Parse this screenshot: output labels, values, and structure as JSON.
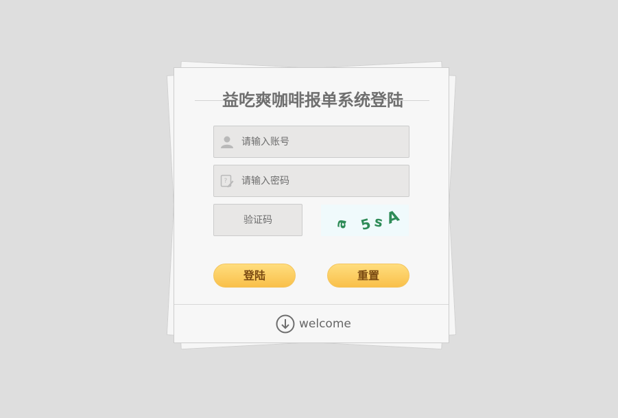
{
  "login": {
    "title": "益吃爽咖啡报单系统登陆",
    "username_placeholder": "请输入账号",
    "password_placeholder": "请输入密码",
    "captcha_placeholder": "验证码",
    "captcha_code": "a5sA",
    "login_label": "登陆",
    "reset_label": "重置"
  },
  "footer": {
    "welcome_label": "welcome",
    "icon": "arrow-down-circle-icon"
  },
  "colors": {
    "background": "#dedede",
    "button": "#f9c04a",
    "captcha_text": "#2e8b57"
  }
}
